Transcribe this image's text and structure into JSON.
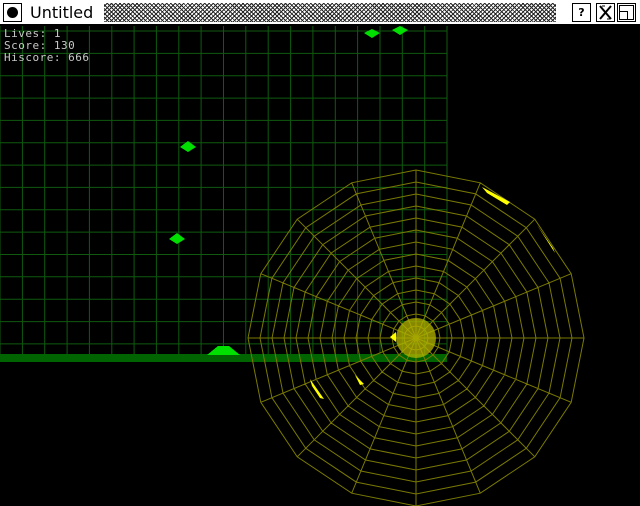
{
  "window": {
    "title": "Untitled",
    "help_label": "?"
  },
  "hud": {
    "lives_label": "Lives:",
    "lives": "1",
    "score_label": "Score:",
    "score": "130",
    "hiscore_label": "Hiscore:",
    "hiscore": "666"
  },
  "colors": {
    "grid": "#0f5a0f",
    "ground": "#006400",
    "ship": "#00e000",
    "web": "#7a7a00",
    "web_core": "#b4b400",
    "yellow": "#ffff00"
  },
  "icons": {
    "close": "close-dot-icon",
    "help": "help-icon",
    "x": "x-close-icon",
    "maximize": "maximize-icon"
  }
}
